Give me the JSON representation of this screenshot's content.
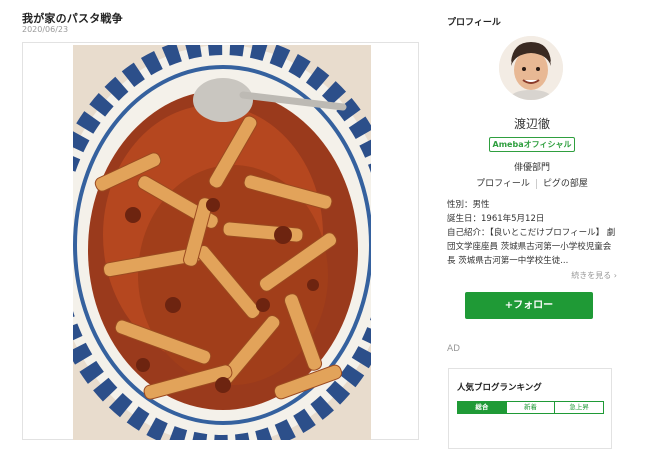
{
  "post": {
    "title": "我が家のパスタ戦争",
    "date": "2020/06/23"
  },
  "sidebar": {
    "heading": "プロフィール",
    "name": "渡辺徹",
    "badge": "Amebaオフィシャル",
    "category": "俳優部門",
    "links": [
      "プロフィール",
      "ピグの部屋"
    ],
    "info": {
      "gender": "性別：男性",
      "birthday": "誕生日：1961年5月12日",
      "intro": "自己紹介：【良いとこだけプロフィール】 劇団文学座座員 茨城県古河第一小学校児童会長 茨城県古河第一中学校生徒..."
    },
    "more_label": "続きを見る",
    "follow_label": "+フォロー",
    "ad_label": "AD",
    "ranking": {
      "title": "人気ブログランキング",
      "tabs": [
        "総合",
        "新着",
        "急上昇"
      ]
    }
  },
  "colors": {
    "accent_green": "#1f9a36",
    "text_dark": "#222222",
    "text_muted": "#999999"
  }
}
